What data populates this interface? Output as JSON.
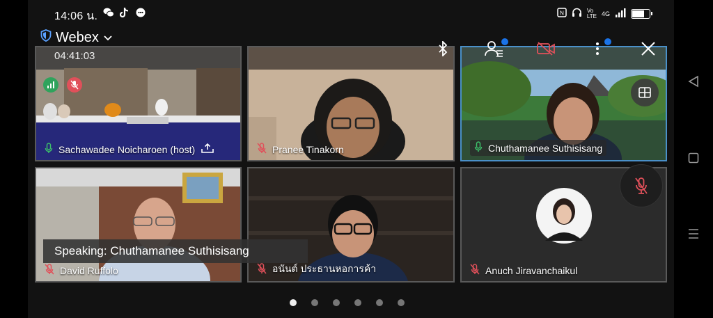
{
  "status_bar": {
    "time": "14:06 น.",
    "left_icons": [
      "wechat-icon",
      "tiktok-icon",
      "chat-bubble-icon"
    ],
    "right_icons": [
      "nfc-icon",
      "headphones-icon",
      "volte-icon",
      "4g-icon",
      "signal-icon",
      "battery-icon"
    ],
    "battery_level": 0.75
  },
  "header": {
    "app_name": "Webex",
    "timer": "04:41:03",
    "accent": "#1a73e8",
    "video_off_color": "#e0505a"
  },
  "participants": [
    {
      "name": "Sachawadee Noicharoen (host)",
      "muted": false,
      "has_share_icon": true
    },
    {
      "name": "Pranee Tinakorn",
      "muted": true
    },
    {
      "name": "Chuthamanee Suthisisang",
      "muted": false,
      "active_speaker": true
    },
    {
      "name": "David Ruffolo",
      "muted": true
    },
    {
      "name": "อนันต์ ประธานหอการค้า",
      "muted": true
    },
    {
      "name": "Anuch Jiravanchaikul",
      "muted": true,
      "avatar_only": true
    }
  ],
  "speaking_banner": "Speaking: Chuthamanee Suthisisang",
  "pager": {
    "count": 6,
    "current": 1
  }
}
